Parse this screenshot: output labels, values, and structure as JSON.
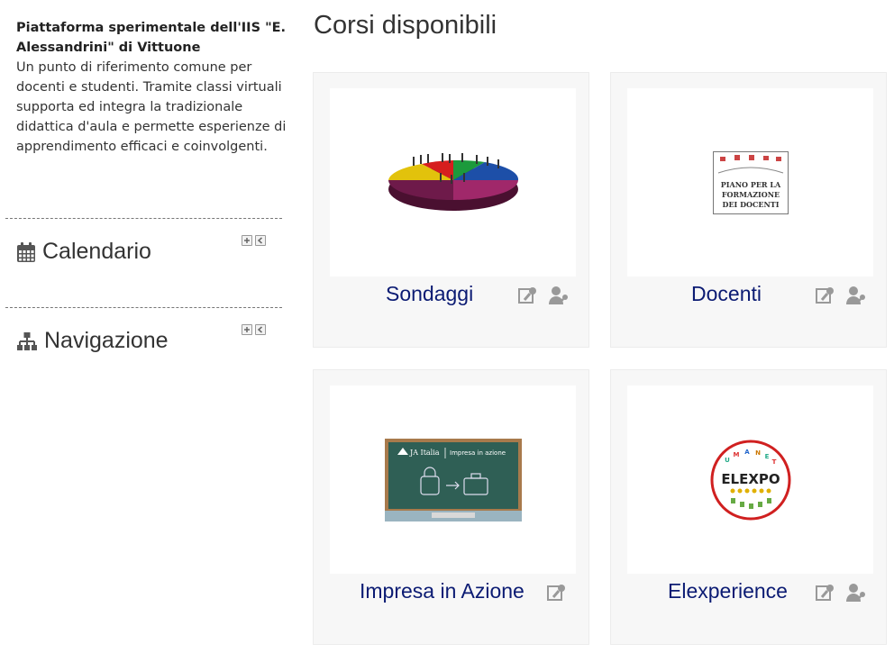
{
  "sidebar": {
    "about_title": "Piattaforma sperimentale dell'IIS \"E. Alessandrini\" di Vittuone",
    "about_text": "Un punto di riferimento comune per docenti e studenti. Tramite classi virtuali supporta ed integra la tradizionale didattica d'aula e permette esperienze di apprendimento efficaci e coinvolgenti.",
    "blocks": [
      {
        "title": "Calendario",
        "icon": "calendar-icon"
      },
      {
        "title": "Navigazione",
        "icon": "sitemap-icon"
      }
    ]
  },
  "main": {
    "title": "Corsi disponibili",
    "courses": [
      {
        "name": "Sondaggi",
        "image": "pie-chart-people",
        "icons": [
          "guest-access-icon",
          "self-enrol-icon"
        ]
      },
      {
        "name": "Docenti",
        "image": "piano-formazione-docenti",
        "image_text": [
          "PIANO PER LA",
          "FORMAZIONE",
          "DEI DOCENTI"
        ],
        "icons": [
          "guest-access-icon",
          "self-enrol-icon"
        ]
      },
      {
        "name": "Impresa in Azione",
        "image": "ja-italia-chalkboard",
        "image_text": [
          "JA Italia",
          "Impresa in azione"
        ],
        "icons": [
          "guest-access-icon"
        ]
      },
      {
        "name": "Elexperience",
        "image": "elexpo-badge",
        "image_text": [
          "ELEXPO"
        ],
        "icons": [
          "guest-access-icon",
          "self-enrol-icon"
        ]
      }
    ]
  },
  "colors": {
    "course_link": "#0b1b73",
    "card_bg": "#f7f7f7"
  }
}
